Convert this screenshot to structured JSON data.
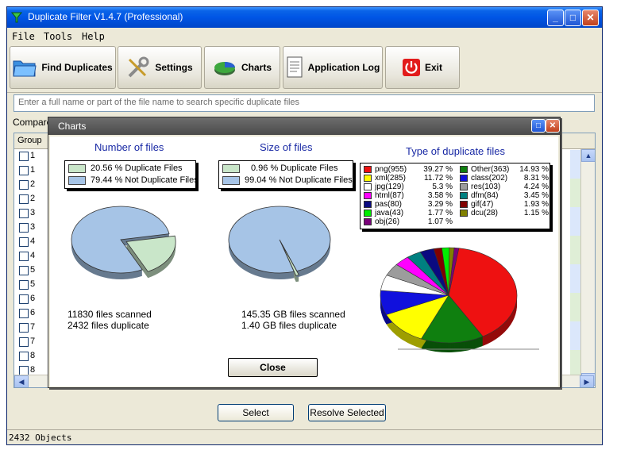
{
  "window": {
    "title": "Duplicate Filter V1.4.7 (Professional)"
  },
  "menu": [
    "File",
    "Tools",
    "Help"
  ],
  "toolbar": {
    "find": "Find Duplicates",
    "settings": "Settings",
    "charts": "Charts",
    "log": "Application Log",
    "exit": "Exit"
  },
  "search": {
    "placeholder": "Enter a full name or part of the file name to search specific duplicate files"
  },
  "compare_label": "Compare",
  "grid": {
    "header": "Group",
    "rows": [
      "1",
      "1",
      "2",
      "2",
      "3",
      "3",
      "4",
      "4",
      "5",
      "5",
      "6",
      "6",
      "7",
      "7",
      "8",
      "8"
    ]
  },
  "buttons": {
    "select": "Select",
    "resolve": "Resolve Selected"
  },
  "status": "2432 Objects",
  "charts_dialog": {
    "title": "Charts",
    "close": "Close",
    "number": {
      "title": "Number of files",
      "legend": [
        "20.56 % Duplicate Files",
        "79.44 % Not Duplicate Files"
      ],
      "scanned": "11830 files scanned",
      "duplicate": "2432 files duplicate"
    },
    "size": {
      "title": "Size of files",
      "legend": [
        "0.96 % Duplicate Files",
        "99.04 % Not Duplicate Files"
      ],
      "scanned": "145.35 GB files scanned",
      "duplicate": "1.40 GB files duplicate"
    },
    "type": {
      "title": "Type of duplicate files"
    }
  },
  "chart_data": [
    {
      "type": "pie",
      "title": "Number of files",
      "labels": [
        "Duplicate Files",
        "Not Duplicate Files"
      ],
      "values": [
        20.56,
        79.44
      ],
      "colors": [
        "#c9e6c9",
        "#a6c4e6"
      ]
    },
    {
      "type": "pie",
      "title": "Size of files",
      "labels": [
        "Duplicate Files",
        "Not Duplicate Files"
      ],
      "values": [
        0.96,
        99.04
      ],
      "colors": [
        "#c9e6c9",
        "#a6c4e6"
      ]
    },
    {
      "type": "pie",
      "title": "Type of duplicate files",
      "labels": [
        "png(955)",
        "xml(285)",
        "jpg(129)",
        "html(87)",
        "pas(80)",
        "java(43)",
        "obj(26)",
        "Other(363)",
        "class(202)",
        "res(103)",
        "dfm(84)",
        "gif(47)",
        "dcu(28)"
      ],
      "values": [
        39.27,
        11.72,
        5.3,
        3.58,
        3.29,
        1.77,
        1.07,
        14.93,
        8.31,
        4.24,
        3.45,
        1.93,
        1.15
      ],
      "value_labels": [
        "39.27 %",
        "11.72 %",
        "5.3 %",
        "3.58 %",
        "3.29 %",
        "1.77 %",
        "1.07 %",
        "14.93 %",
        "8.31 %",
        "4.24 %",
        "3.45 %",
        "1.93 %",
        "1.15 %"
      ],
      "colors": [
        "#ee1111",
        "#ffff00",
        "#ffffff",
        "#ff00ff",
        "#0a0a80",
        "#00ee00",
        "#7a007a",
        "#0f7f0f",
        "#1010dd",
        "#9c9c9c",
        "#008080",
        "#800000",
        "#808000"
      ],
      "pie_order": [
        0,
        7,
        1,
        8,
        2,
        9,
        3,
        10,
        4,
        11,
        5,
        12,
        6
      ]
    }
  ]
}
